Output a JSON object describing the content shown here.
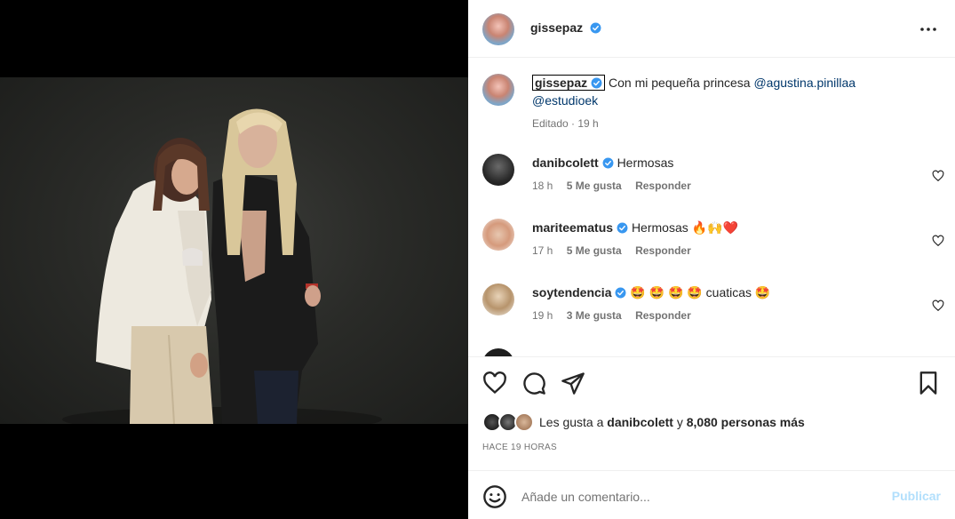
{
  "post": {
    "author": "gissepaz",
    "caption_text": "Con mi pequeña princesa",
    "mentions": [
      "@agustina.pinillaa",
      "@estudioek"
    ],
    "caption_meta": "Editado · 19 h"
  },
  "comments": [
    {
      "user": "danibcolett",
      "text": "Hermosas",
      "time": "18 h",
      "likes": "5 Me gusta",
      "reply": "Responder"
    },
    {
      "user": "mariteematus",
      "text": "Hermosas",
      "emoji": "🔥🙌❤️",
      "time": "17 h",
      "likes": "5 Me gusta",
      "reply": "Responder"
    },
    {
      "user": "soytendencia",
      "emoji_pre": "🤩 🤩 🤩 🤩",
      "text": "cuaticas",
      "emoji": "🤩",
      "time": "19 h",
      "likes": "3 Me gusta",
      "reply": "Responder"
    }
  ],
  "likes": {
    "prefix": "Les gusta a",
    "user": "danibcolett",
    "joiner": "y",
    "count": "8,080 personas más"
  },
  "timestamp": "HACE 19 HORAS",
  "composer": {
    "placeholder": "Añade un comentario...",
    "publish": "Publicar"
  },
  "colors": {
    "verified": "#3897f0",
    "mention": "#00376b",
    "publish_disabled": "#b2dffc",
    "muted": "#737373"
  },
  "icons": [
    "more-icon",
    "verified-icon",
    "heart-icon",
    "comment-icon",
    "share-icon",
    "bookmark-icon",
    "emoji-icon"
  ]
}
